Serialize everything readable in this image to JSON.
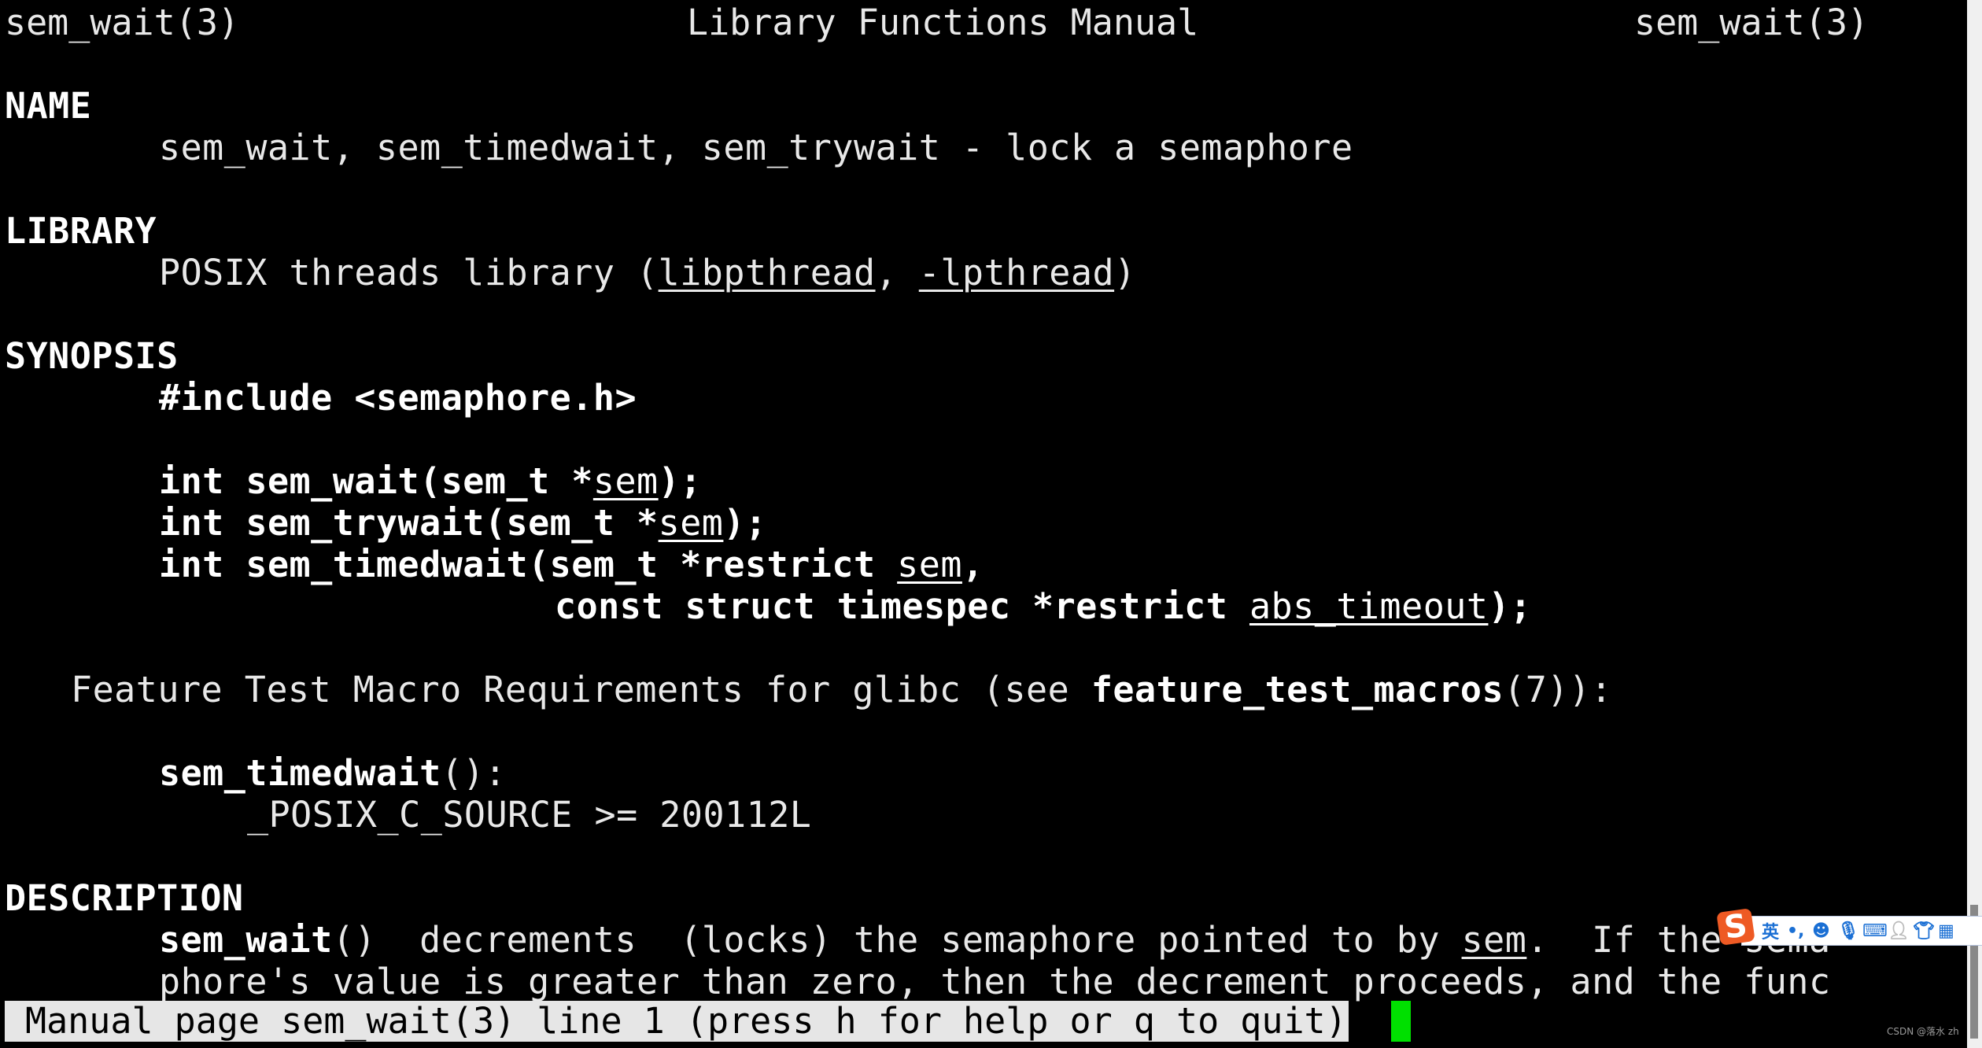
{
  "header": {
    "left": "sem_wait(3)",
    "center": "Library Functions Manual",
    "right": "sem_wait(3)"
  },
  "sections": {
    "name": {
      "title": "NAME",
      "text": "sem_wait, sem_timedwait, sem_trywait - lock a semaphore"
    },
    "library": {
      "title": "LIBRARY",
      "prefix": "POSIX threads library (",
      "lib1": "libpthread",
      "sep": ", ",
      "lib2": "-lpthread",
      "suffix": ")"
    },
    "synopsis": {
      "title": "SYNOPSIS",
      "include": "#include <semaphore.h>",
      "proto1": {
        "decl": "int sem_wait(sem_t *",
        "arg": "sem",
        "end": ");"
      },
      "proto2": {
        "decl": "int sem_trywait(sem_t *",
        "arg": "sem",
        "end": ");"
      },
      "proto3": {
        "decl": "int sem_timedwait(sem_t *restrict ",
        "arg": "sem",
        "end": ","
      },
      "proto3b": {
        "decl": "const struct timespec *restrict ",
        "arg": "abs_timeout",
        "end": ");"
      },
      "ftm": {
        "prefix": "Feature Test Macro Requirements for glibc (see ",
        "ref": "feature_test_macros",
        "suffix": "(7)):"
      },
      "ftm_func": "sem_timedwait",
      "ftm_func_suffix": "():",
      "ftm_value": "_POSIX_C_SOURCE >= 200112L"
    },
    "description": {
      "title": "DESCRIPTION",
      "line1": {
        "func": "sem_wait",
        "a": "()  decrements  (locks) the semaphore pointed to by ",
        "arg": "sem",
        "b": ".  If the sema"
      },
      "line2": "phore's value is greater than zero, then the decrement proceeds, and the func"
    }
  },
  "statusbar": {
    "text": "Manual page sem_wait(3) line 1 (press h for help or q to quit)"
  },
  "ime": {
    "logo": "S",
    "lang": "英",
    "punct": "•,",
    "items": [
      "emoji-icon",
      "microphone-icon",
      "keyboard-icon",
      "user-icon",
      "skin-icon",
      "apps-icon"
    ]
  },
  "watermark": "CSDN @落水 zh"
}
